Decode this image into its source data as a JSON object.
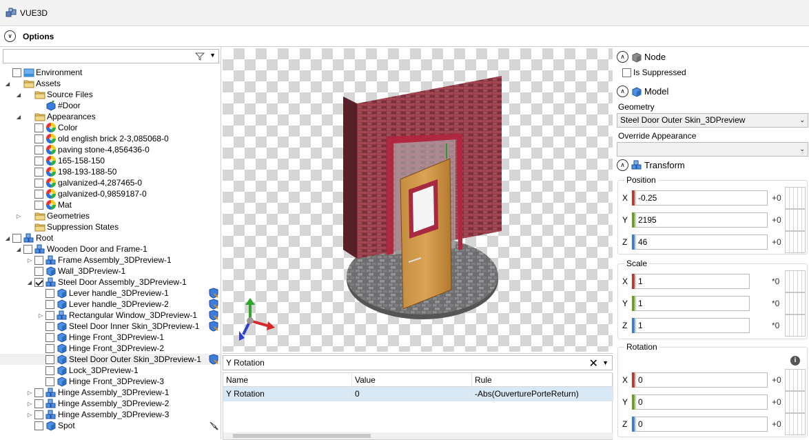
{
  "app": {
    "title": "VUE3D"
  },
  "options": {
    "label": "Options"
  },
  "tree": [
    {
      "label": "Environment"
    },
    {
      "label": "Assets"
    },
    {
      "label": "Source Files"
    },
    {
      "label": "#Door"
    },
    {
      "label": "Appearances"
    },
    {
      "label": "Color"
    },
    {
      "label": "old english brick 2-3,085068-0"
    },
    {
      "label": "paving stone-4,856436-0"
    },
    {
      "label": "165-158-150"
    },
    {
      "label": "198-193-188-50"
    },
    {
      "label": "galvanized-4,287465-0"
    },
    {
      "label": "galvanized-0,9859187-0"
    },
    {
      "label": "Mat"
    },
    {
      "label": "Geometries"
    },
    {
      "label": "Suppression States"
    },
    {
      "label": "Root"
    },
    {
      "label": "Wooden Door and Frame-1"
    },
    {
      "label": "Frame Assembly_3DPreview-1"
    },
    {
      "label": "Wall_3DPreview-1"
    },
    {
      "label": "Steel Door Assembly_3DPreview-1"
    },
    {
      "label": "Lever handle_3DPreview-1"
    },
    {
      "label": "Lever handle_3DPreview-2"
    },
    {
      "label": "Rectangular Window_3DPreview-1"
    },
    {
      "label": "Steel Door Inner Skin_3DPreview-1"
    },
    {
      "label": "Hinge Front_3DPreview-1"
    },
    {
      "label": "Hinge Front_3DPreview-2"
    },
    {
      "label": "Steel Door Outer Skin_3DPreview-1"
    },
    {
      "label": "Lock_3DPreview-1"
    },
    {
      "label": "Hinge Front_3DPreview-3"
    },
    {
      "label": "Hinge Assembly_3DPreview-1"
    },
    {
      "label": "Hinge Assembly_3DPreview-2"
    },
    {
      "label": "Hinge Assembly_3DPreview-3"
    },
    {
      "label": "Spot"
    }
  ],
  "rules": {
    "search_value": "Y Rotation",
    "columns": [
      "Name",
      "Value",
      "Rule"
    ],
    "rows": [
      {
        "name": "Y Rotation",
        "value": "0",
        "rule": "-Abs(OuverturePorteReturn)"
      }
    ]
  },
  "props": {
    "node": {
      "title": "Node",
      "is_suppressed_label": "Is Suppressed"
    },
    "model": {
      "title": "Model",
      "geometry_label": "Geometry",
      "geometry_value": "Steel Door Outer Skin_3DPreview",
      "override_label": "Override Appearance",
      "override_value": ""
    },
    "transform": {
      "title": "Transform",
      "position": {
        "title": "Position",
        "x": "-0.25",
        "y": "2195",
        "z": "46",
        "op": "+0"
      },
      "scale": {
        "title": "Scale",
        "x": "1",
        "y": "1",
        "z": "1",
        "op": "*0"
      },
      "rotation": {
        "title": "Rotation",
        "x": "0",
        "y": "0",
        "z": "0",
        "op": "+0"
      }
    },
    "axis_labels": {
      "x": "X",
      "y": "Y",
      "z": "Z"
    }
  },
  "colors": {
    "x_axis": "#c0392b",
    "y_axis": "#6aa121",
    "z_axis": "#3b7ddd",
    "selection": "#d9e8f5"
  }
}
